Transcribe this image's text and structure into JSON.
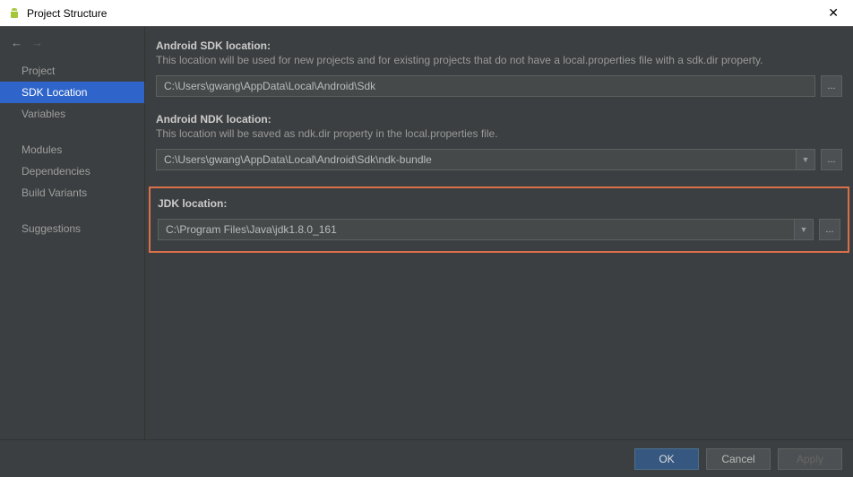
{
  "window": {
    "title": "Project Structure"
  },
  "nav": {
    "items": [
      {
        "label": "Project"
      },
      {
        "label": "SDK Location"
      },
      {
        "label": "Variables"
      }
    ],
    "items2": [
      {
        "label": "Modules"
      },
      {
        "label": "Dependencies"
      },
      {
        "label": "Build Variants"
      }
    ],
    "items3": [
      {
        "label": "Suggestions"
      }
    ]
  },
  "sdk": {
    "label": "Android SDK location:",
    "desc": "This location will be used for new projects and for existing projects that do not have a local.properties file with a sdk.dir property.",
    "value": "C:\\Users\\gwang\\AppData\\Local\\Android\\Sdk",
    "browse": "..."
  },
  "ndk": {
    "label": "Android NDK location:",
    "desc": "This location will be saved as ndk.dir property in the local.properties file.",
    "value": "C:\\Users\\gwang\\AppData\\Local\\Android\\Sdk\\ndk-bundle",
    "dropdown": "▼",
    "browse": "..."
  },
  "jdk": {
    "label": "JDK location:",
    "value": "C:\\Program Files\\Java\\jdk1.8.0_161",
    "dropdown": "▼",
    "browse": "..."
  },
  "footer": {
    "ok": "OK",
    "cancel": "Cancel",
    "apply": "Apply"
  }
}
